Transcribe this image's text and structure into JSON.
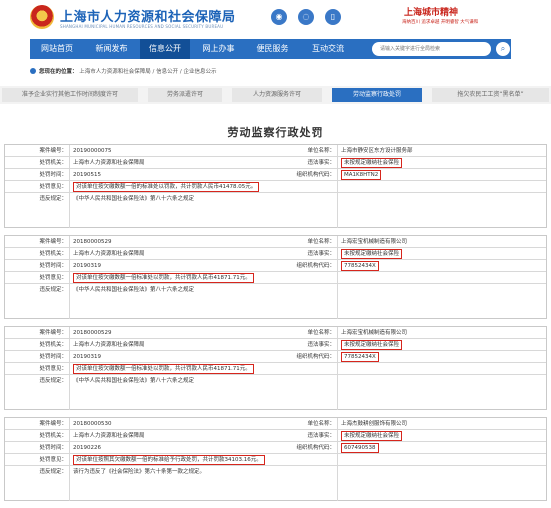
{
  "header": {
    "site_title": "上海市人力资源和社会保障局",
    "site_subtitle": "SHANGHAI MUNICIPAL HUMAN RESOURCES AND SOCIAL SECURITY BUREAU",
    "slogan_main": "上海城市精神",
    "slogan_sub": "海纳百川 追求卓越 开明睿智 大气谦和",
    "icons": [
      "weibo-icon",
      "wechat-icon",
      "app-icon"
    ]
  },
  "nav": {
    "items": [
      {
        "label": "网站首页"
      },
      {
        "label": "新闻发布"
      },
      {
        "label": "信息公开"
      },
      {
        "label": "网上办事"
      },
      {
        "label": "便民服务"
      },
      {
        "label": "互动交流"
      }
    ],
    "active_index": 2,
    "search_placeholder": "请输入关键字进行全局检索"
  },
  "breadcrumb": {
    "prefix": "您现在的位置：",
    "path": "上海市人力资源和社会保障局 / 信息公开 / 企业信息公示"
  },
  "tabs": [
    {
      "label": "准予企业实行其他工作时间制度许可"
    },
    {
      "label": "劳务派遣许可"
    },
    {
      "label": "人力资源服务许可"
    },
    {
      "label": "劳动监察行政处罚"
    },
    {
      "label": "拖欠农民工工资“黑名单”"
    }
  ],
  "active_tab": 3,
  "page_title": "劳动监察行政处罚",
  "labels": {
    "case_no": "案件编号：",
    "unit_name": "单位名称：",
    "authority": "处罚机关：",
    "violation": "违法事实：",
    "penalty_date": "处罚时间：",
    "org_code": "组织机构代码：",
    "opinion": "处罚意见：",
    "basis": "违反规定："
  },
  "records": [
    {
      "case_no": "20190000075",
      "unit_name": "上海市静安区东方设计服务部",
      "authority": "上海市人力资源和社会保障局",
      "violation": "未按规定缴纳社会保险",
      "penalty_date": "20190515",
      "org_code": "MA1K8HTN2",
      "opinion": "对该单位按欠缴数额一倍的标准处以罚款，共计罚款人民币41478.05元。",
      "basis": "《中华人民共和国社会保险法》第八十六条之规定"
    },
    {
      "case_no": "20180000529",
      "unit_name": "上海宏宝机械制造有限公司",
      "authority": "上海市人力资源和社会保障局",
      "violation": "未按规定缴纳社会保险",
      "penalty_date": "20190319",
      "org_code": "77852434X",
      "opinion": "对该单位按欠缴数额一倍标准处以罚款，共计罚款人民币41871.71元。",
      "basis": "《中华人民共和国社会保险法》第八十六条之规定"
    },
    {
      "case_no": "20180000529",
      "unit_name": "上海宏宝机械制造有限公司",
      "authority": "上海市人力资源和社会保障局",
      "violation": "未按规定缴纳社会保险",
      "penalty_date": "20190319",
      "org_code": "77852434X",
      "opinion": "对该单位按欠缴数额一倍标准处以罚款，共计罚款人民币41871.71元。",
      "basis": "《中华人民共和国社会保险法》第八十六条之规定"
    },
    {
      "case_no": "20180000530",
      "unit_name": "上海杰鼓耕创服饰有限公司",
      "authority": "上海市人力资源和社会保障局",
      "violation": "未按规定缴纳社会保险",
      "penalty_date": "20190226",
      "org_code": "607490538",
      "opinion": "对该单位按照其欠缴数额一倍的标准给予行政处罚，共计罚款34103.16元。",
      "basis": "该行为违反了《社会保险法》第六十条第一款之规定。"
    }
  ]
}
